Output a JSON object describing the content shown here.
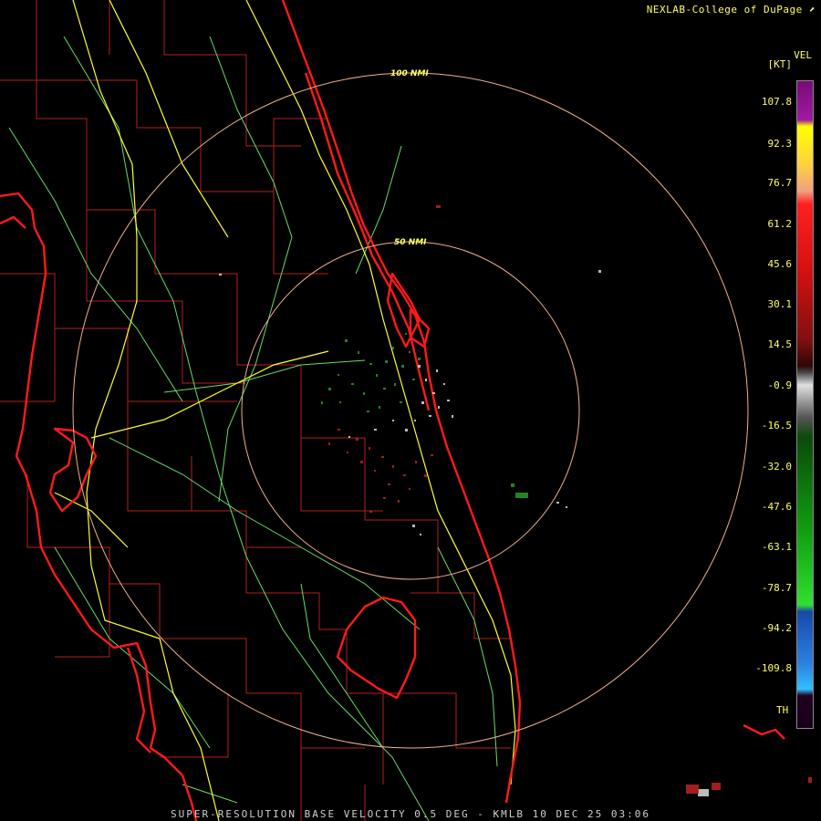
{
  "credit": "NEXLAB-College of DuPage",
  "footer": "SUPER-RESOLUTION BASE VELOCITY 0.5 DEG - KMLB 10 DEC 25 03:06",
  "colorbar": {
    "product": "VEL",
    "unit": "[KT]",
    "ticks": [
      "107.8",
      "92.3",
      "76.7",
      "61.2",
      "45.6",
      "30.1",
      "14.5",
      "-0.9",
      "-16.5",
      "-32.0",
      "-47.6",
      "-63.1",
      "-78.7",
      "-94.2",
      "-109.8"
    ],
    "th_label": "TH"
  },
  "range_rings": [
    "100 NMI",
    "50 NMI"
  ],
  "colors": {
    "coastline": "#ff1a1a",
    "county": "#b21f1f",
    "highway_major": "#ffff33",
    "highway_minor": "#66dd66",
    "ring": "#f2b08c",
    "text": "#ffff66"
  }
}
